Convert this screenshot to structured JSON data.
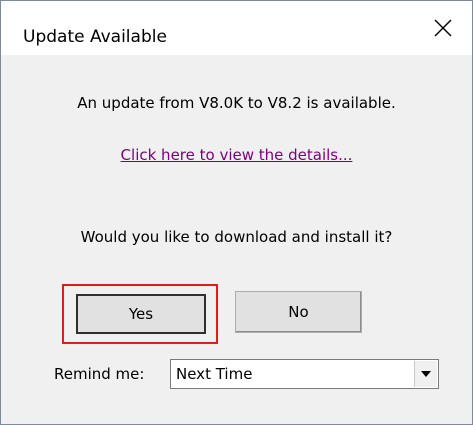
{
  "window": {
    "title": "Update Available"
  },
  "message": {
    "update_text": "An update from V8.0K to V8.2 is available.",
    "details_link": "Click here to view the details...",
    "question": "Would you like to download and install it?"
  },
  "buttons": {
    "yes_label": "Yes",
    "no_label": "No"
  },
  "remind": {
    "label": "Remind me:",
    "selected": "Next Time"
  },
  "icons": {
    "close": "close-icon",
    "dropdown": "chevron-down-icon"
  },
  "colors": {
    "link": "#800080",
    "highlight": "#e01b1b",
    "dialog_bg": "#f0f0f0",
    "button_bg": "#e1e1e1"
  }
}
